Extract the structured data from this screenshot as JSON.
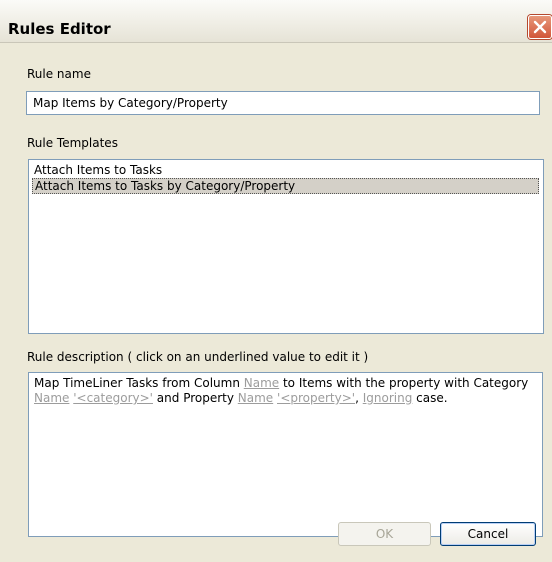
{
  "window": {
    "title": "Rules Editor",
    "close_icon": "close-icon"
  },
  "rule_name": {
    "label": "Rule name",
    "value": "Map Items by Category/Property"
  },
  "rule_templates": {
    "label": "Rule Templates",
    "items": [
      {
        "label": "Attach Items to Tasks",
        "selected": false
      },
      {
        "label": "Attach Items to Tasks by Category/Property",
        "selected": true
      }
    ]
  },
  "rule_description": {
    "label": "Rule description ( click on an underlined value to edit it )",
    "t1": "Map TimeLiner Tasks from Column ",
    "link1": "Name",
    "t2": " to Items with the property with Category ",
    "link2": "Name",
    "t3": " ",
    "link3": "'<category>'",
    "t4": " and Property ",
    "link4": "Name",
    "t5": " ",
    "link5": "'<property>'",
    "t6": ", ",
    "link6": "Ignoring",
    "t7": " case."
  },
  "buttons": {
    "ok": "OK",
    "cancel": "Cancel"
  },
  "colors": {
    "link": "#9c9c9c",
    "window_bg": "#ece9d8",
    "close_button": "#d2553a"
  }
}
